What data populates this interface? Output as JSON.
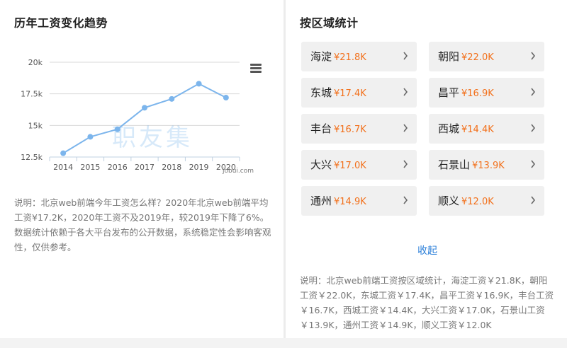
{
  "left": {
    "title": "历年工资变化趋势",
    "description": "说明：北京web前端今年工资怎么样？2020年北京web前端平均工资¥17.2K，2020年工资不及2019年，较2019年下降了6%。数据统计依赖于各大平台发布的公开数据，系统稳定性会影响客观性，仅供参考。",
    "icons": {
      "menu": "hamburger-menu-icon"
    }
  },
  "chart_data": {
    "type": "line",
    "x": [
      "2014",
      "2015",
      "2016",
      "2017",
      "2018",
      "2019",
      "2020"
    ],
    "series": [
      {
        "values": [
          12.8,
          14.1,
          14.7,
          16.4,
          17.1,
          18.3,
          17.2
        ]
      }
    ],
    "yticks": [
      "12.5k",
      "15k",
      "17.5k",
      "20k"
    ],
    "ylim": [
      12.5,
      20
    ],
    "grid": true,
    "line_color": "#7cb5ec",
    "watermark": "职友集",
    "credit": "jobui.com"
  },
  "right": {
    "title": "按区域统计",
    "regions": [
      {
        "name": "海淀",
        "value": "¥21.8K"
      },
      {
        "name": "朝阳",
        "value": "¥22.0K"
      },
      {
        "name": "东城",
        "value": "¥17.4K"
      },
      {
        "name": "昌平",
        "value": "¥16.9K"
      },
      {
        "name": "丰台",
        "value": "¥16.7K"
      },
      {
        "name": "西城",
        "value": "¥14.4K"
      },
      {
        "name": "大兴",
        "value": "¥17.0K"
      },
      {
        "name": "石景山",
        "value": "¥13.9K"
      },
      {
        "name": "通州",
        "value": "¥14.9K"
      },
      {
        "name": "顺义",
        "value": "¥12.0K"
      }
    ],
    "collapse_label": "收起",
    "description": "说明：北京web前端工资按区域统计，海淀工资￥21.8K，朝阳工资￥22.0K，东城工资￥17.4K，昌平工资￥16.9K，丰台工资￥16.7K，西城工资￥14.4K，大兴工资￥17.0K，石景山工资￥13.9K，通州工资￥14.9K，顺义工资￥12.0K",
    "accent_color": "#f2701b",
    "link_color": "#2b7fd9"
  }
}
